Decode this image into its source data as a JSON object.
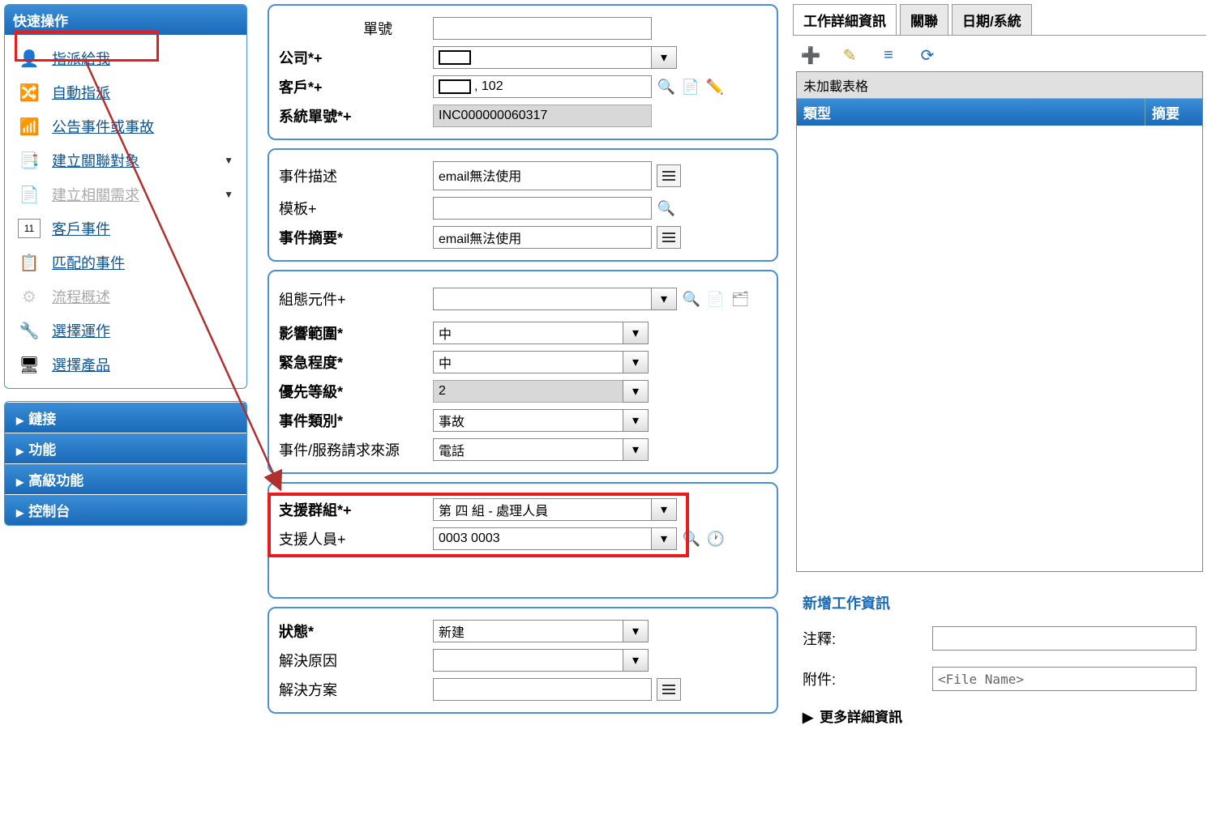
{
  "sidebar": {
    "title": "快速操作",
    "items": [
      {
        "label": "指派給我",
        "icon": "person-assign",
        "disabled": false,
        "arrow": false
      },
      {
        "label": "自動指派",
        "icon": "auto-arrows",
        "disabled": false,
        "arrow": false
      },
      {
        "label": "公告事件或事故",
        "icon": "rss",
        "disabled": false,
        "arrow": false
      },
      {
        "label": "建立關聯對象",
        "icon": "link-doc",
        "disabled": false,
        "arrow": true
      },
      {
        "label": "建立相關需求",
        "icon": "add-doc",
        "disabled": true,
        "arrow": true
      },
      {
        "label": "客戶事件",
        "icon": "calendar",
        "disabled": false,
        "arrow": false
      },
      {
        "label": "匹配的事件",
        "icon": "match",
        "disabled": false,
        "arrow": false
      },
      {
        "label": "流程概述",
        "icon": "flow",
        "disabled": true,
        "arrow": false
      },
      {
        "label": "選擇運作",
        "icon": "select-op",
        "disabled": false,
        "arrow": false
      },
      {
        "label": "選擇產品",
        "icon": "select-prod",
        "disabled": false,
        "arrow": false
      }
    ],
    "nav": [
      "鏈接",
      "功能",
      "高級功能",
      "控制台"
    ]
  },
  "form": {
    "group1": {
      "id_label": "單號",
      "company_label": "公司*+",
      "customer_label": "客戶*+",
      "customer_value": ", 102",
      "sysid_label": "系統單號*+",
      "sysid_value": "INC000000060317"
    },
    "group2": {
      "desc_label": "事件描述",
      "desc_value": "email無法使用",
      "template_label": "模板+",
      "summary_label": "事件摘要*",
      "summary_value": "email無法使用"
    },
    "group3": {
      "ci_label": "組態元件+",
      "impact_label": "影響範圍*",
      "impact_value": "中",
      "urgency_label": "緊急程度*",
      "urgency_value": "中",
      "priority_label": "優先等級*",
      "priority_value": "2",
      "type_label": "事件類別*",
      "type_value": "事故",
      "source_label": "事件/服務請求來源",
      "source_value": "電話"
    },
    "group4": {
      "group_label": "支援群組*+",
      "group_value": "第 四 組 - 處理人員",
      "person_label": "支援人員+",
      "person_value": "0003 0003"
    },
    "group5": {
      "status_label": "狀態*",
      "status_value": "新建",
      "reason_label": "解決原因",
      "solution_label": "解決方案"
    }
  },
  "right": {
    "tabs": [
      "工作詳細資訊",
      "關聯",
      "日期/系統"
    ],
    "table_title": "未加載表格",
    "col1": "類型",
    "col2": "摘要",
    "info_header": "新增工作資訊",
    "note_label": "注釋:",
    "attach_label": "附件:",
    "attach_placeholder": "<File Name>",
    "more_label": "更多詳細資訊"
  }
}
